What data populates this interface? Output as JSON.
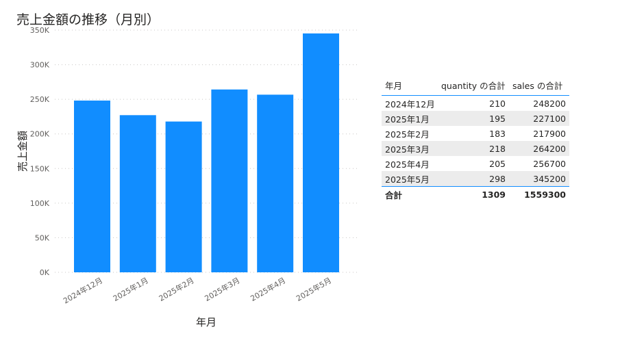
{
  "chart_data": {
    "type": "bar",
    "title": "売上金額の推移（月別）",
    "xlabel": "年月",
    "ylabel": "売上金額",
    "categories": [
      "2024年12月",
      "2025年1月",
      "2025年2月",
      "2025年3月",
      "2025年4月",
      "2025年5月"
    ],
    "values": [
      248200,
      227100,
      217900,
      264200,
      256700,
      345200
    ],
    "ylim": [
      0,
      350000
    ],
    "yticks": [
      0,
      50000,
      100000,
      150000,
      200000,
      250000,
      300000,
      350000
    ],
    "ytick_labels": [
      "0K",
      "50K",
      "100K",
      "150K",
      "200K",
      "250K",
      "300K",
      "350K"
    ],
    "grid": true,
    "bar_color": "#118dff"
  },
  "table": {
    "headers": [
      "年月",
      "quantity の合計",
      "sales の合計"
    ],
    "rows": [
      [
        "2024年12月",
        "210",
        "248200"
      ],
      [
        "2025年1月",
        "195",
        "227100"
      ],
      [
        "2025年2月",
        "183",
        "217900"
      ],
      [
        "2025年3月",
        "218",
        "264200"
      ],
      [
        "2025年4月",
        "205",
        "256700"
      ],
      [
        "2025年5月",
        "298",
        "345200"
      ]
    ],
    "total": [
      "合計",
      "1309",
      "1559300"
    ],
    "accent_color": "#118dff"
  }
}
